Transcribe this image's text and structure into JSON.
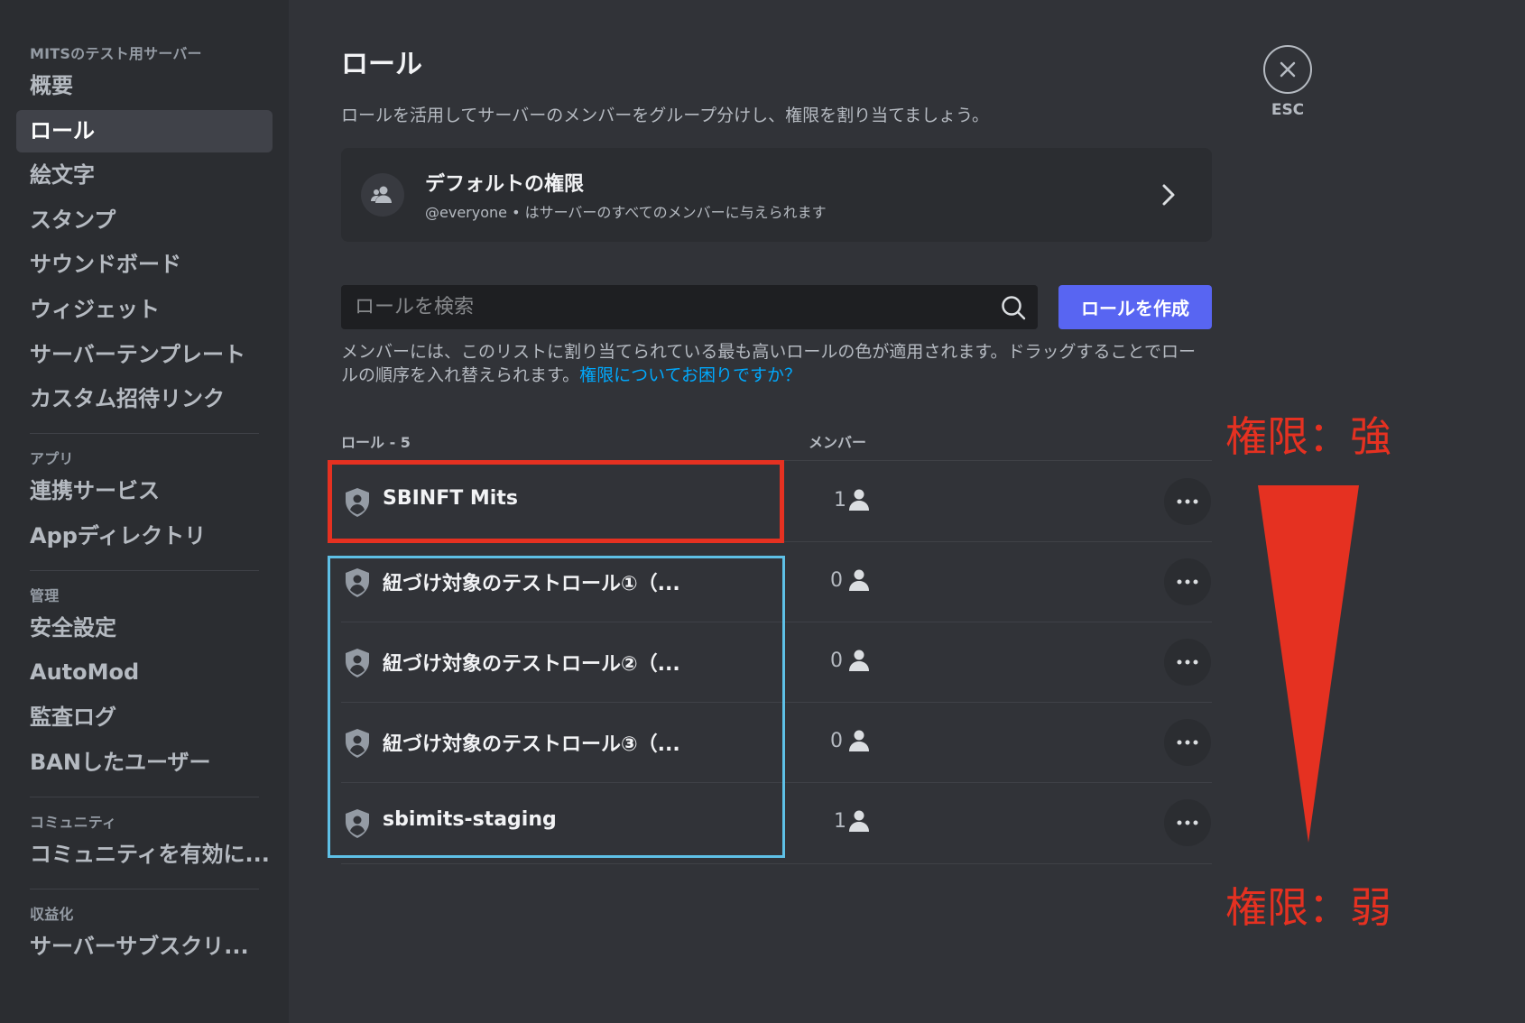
{
  "sidebar": {
    "server_header": "MITSのテスト用サーバー",
    "items": [
      {
        "label": "概要"
      },
      {
        "label": "ロール"
      },
      {
        "label": "絵文字"
      },
      {
        "label": "スタンプ"
      },
      {
        "label": "サウンドボード"
      },
      {
        "label": "ウィジェット"
      },
      {
        "label": "サーバーテンプレート"
      },
      {
        "label": "カスタム招待リンク"
      }
    ],
    "apps_header": "アプリ",
    "apps_items": [
      {
        "label": "連携サービス"
      },
      {
        "label": "Appディレクトリ"
      }
    ],
    "moderation_header": "管理",
    "moderation_items": [
      {
        "label": "安全設定"
      },
      {
        "label": "AutoMod"
      },
      {
        "label": "監査ログ"
      },
      {
        "label": "BANしたユーザー"
      }
    ],
    "community_header": "コミュニティ",
    "community_items": [
      {
        "label": "コミュニティを有効に..."
      }
    ],
    "monetization_header": "収益化",
    "monetization_items": [
      {
        "label": "サーバーサブスクリ..."
      }
    ]
  },
  "main": {
    "title": "ロール",
    "description": "ロールを活用してサーバーのメンバーをグループ分けし、権限を割り当てましょう。",
    "default_perms": {
      "title": "デフォルトの権限",
      "subtitle": "@everyone • はサーバーのすべてのメンバーに与えられます"
    },
    "search": {
      "placeholder": "ロールを検索"
    },
    "create_button": "ロールを作成",
    "hint": "メンバーには、このリストに割り当てられている最も高いロールの色が適用されます。ドラッグすることでロールの順序を入れ替えられます。",
    "hint_link": "権限についてお困りですか？",
    "table": {
      "roles_header": "ロール - 5",
      "members_header": "メンバー",
      "rows": [
        {
          "name": "SBINFT Mits",
          "members": "1"
        },
        {
          "name": "紐づけ対象のテストロール①（...",
          "members": "0"
        },
        {
          "name": "紐づけ対象のテストロール②（...",
          "members": "0"
        },
        {
          "name": "紐づけ対象のテストロール③（...",
          "members": "0"
        },
        {
          "name": "sbimits-staging",
          "members": "1"
        }
      ]
    }
  },
  "close": {
    "label": "ESC"
  },
  "annotations": {
    "strong": "権限：強",
    "weak": "権限：弱",
    "color_red": "#e53121",
    "color_blue": "#5ec0e6"
  }
}
